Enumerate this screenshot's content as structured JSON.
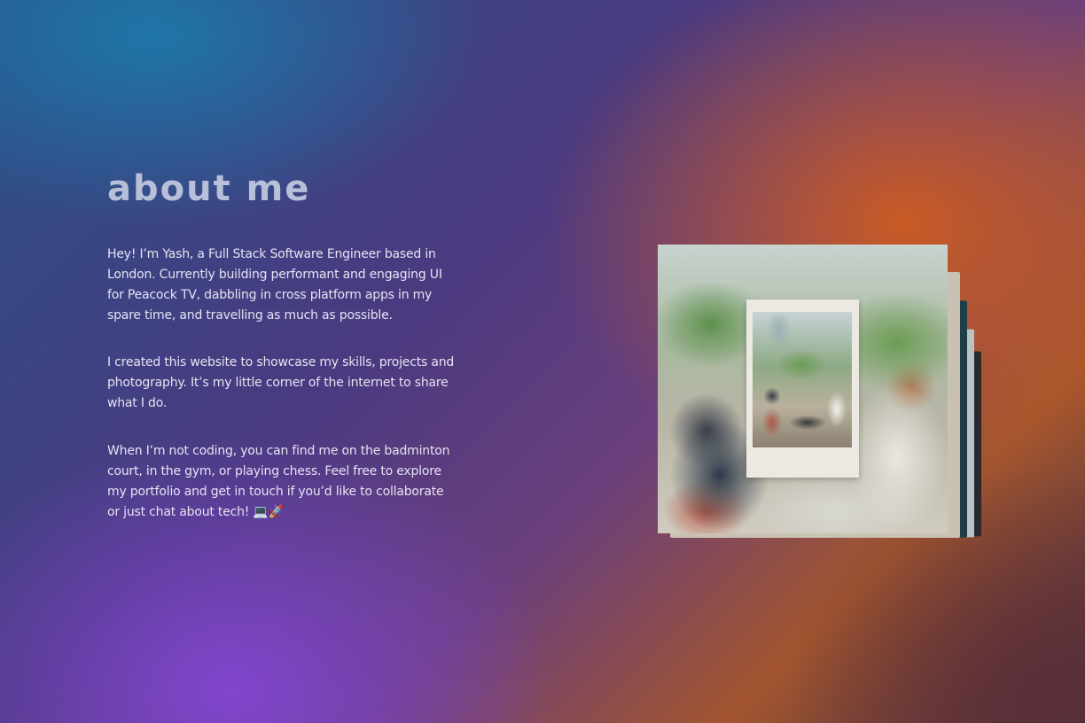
{
  "about": {
    "title": "about me",
    "paragraphs": [
      "Hey! I’m Yash, a Full Stack Software Engineer based in London. Currently building performant and engaging UI for Peacock TV, dabbling in cross platform apps in my spare time, and travelling as much as possible.",
      "I created this website to showcase my skills, projects and photography. It’s my little corner of the internet to share what I do.",
      "When I’m not coding, you can find me on the badminton court, in the gym, or playing chess. Feel free to explore my portfolio and get in touch if you’d like to collaborate or just chat about tech! 💻🚀"
    ]
  },
  "photo": {
    "subject": "people-playing-chess-photo",
    "has_polaroid": true
  },
  "colors": {
    "title": "#b8bfd8",
    "text": "#e6e2f2",
    "gradient_blue": "#1e78aa",
    "gradient_purple": "#8246d2",
    "gradient_orange": "#cd5c20"
  }
}
